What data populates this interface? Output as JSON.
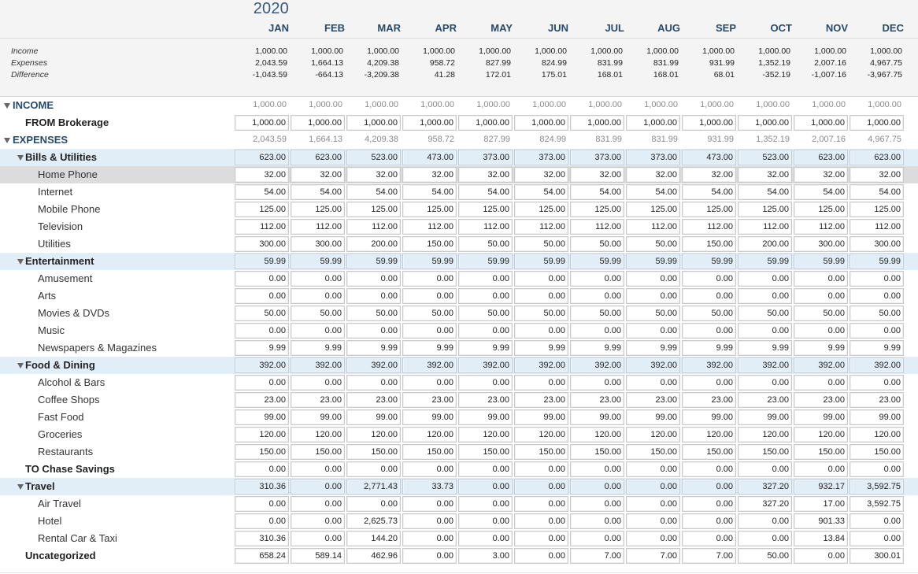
{
  "year": "2020",
  "months": [
    "JAN",
    "FEB",
    "MAR",
    "APR",
    "MAY",
    "JUN",
    "JUL",
    "AUG",
    "SEP",
    "OCT",
    "NOV",
    "DEC"
  ],
  "summary": [
    {
      "label": "Income",
      "values": [
        "1,000.00",
        "1,000.00",
        "1,000.00",
        "1,000.00",
        "1,000.00",
        "1,000.00",
        "1,000.00",
        "1,000.00",
        "1,000.00",
        "1,000.00",
        "1,000.00",
        "1,000.00"
      ]
    },
    {
      "label": "Expenses",
      "values": [
        "2,043.59",
        "1,664.13",
        "4,209.38",
        "958.72",
        "827.99",
        "824.99",
        "831.99",
        "831.99",
        "931.99",
        "1,352.19",
        "2,007.16",
        "4,967.75"
      ]
    },
    {
      "label": "Difference",
      "values": [
        "-1,043.59",
        "-664.13",
        "-3,209.38",
        "41.28",
        "172.01",
        "175.01",
        "168.01",
        "168.01",
        "68.01",
        "-352.19",
        "-1,007.16",
        "-3,967.75"
      ]
    }
  ],
  "rows": [
    {
      "label": "INCOME",
      "kind": "section",
      "values": [
        "1,000.00",
        "1,000.00",
        "1,000.00",
        "1,000.00",
        "1,000.00",
        "1,000.00",
        "1,000.00",
        "1,000.00",
        "1,000.00",
        "1,000.00",
        "1,000.00",
        "1,000.00"
      ]
    },
    {
      "label": "FROM Brokerage",
      "kind": "cat-leaf",
      "values": [
        "1,000.00",
        "1,000.00",
        "1,000.00",
        "1,000.00",
        "1,000.00",
        "1,000.00",
        "1,000.00",
        "1,000.00",
        "1,000.00",
        "1,000.00",
        "1,000.00",
        "1,000.00"
      ]
    },
    {
      "label": "EXPENSES",
      "kind": "section",
      "values": [
        "2,043.59",
        "1,664.13",
        "4,209.38",
        "958.72",
        "827.99",
        "824.99",
        "831.99",
        "831.99",
        "931.99",
        "1,352.19",
        "2,007.16",
        "4,967.75"
      ]
    },
    {
      "label": "Bills & Utilities",
      "kind": "group",
      "values": [
        "623.00",
        "623.00",
        "523.00",
        "473.00",
        "373.00",
        "373.00",
        "373.00",
        "373.00",
        "473.00",
        "523.00",
        "623.00",
        "623.00"
      ]
    },
    {
      "label": "Home Phone",
      "kind": "sub",
      "selected": true,
      "values": [
        "32.00",
        "32.00",
        "32.00",
        "32.00",
        "32.00",
        "32.00",
        "32.00",
        "32.00",
        "32.00",
        "32.00",
        "32.00",
        "32.00"
      ]
    },
    {
      "label": "Internet",
      "kind": "sub",
      "values": [
        "54.00",
        "54.00",
        "54.00",
        "54.00",
        "54.00",
        "54.00",
        "54.00",
        "54.00",
        "54.00",
        "54.00",
        "54.00",
        "54.00"
      ]
    },
    {
      "label": "Mobile Phone",
      "kind": "sub",
      "values": [
        "125.00",
        "125.00",
        "125.00",
        "125.00",
        "125.00",
        "125.00",
        "125.00",
        "125.00",
        "125.00",
        "125.00",
        "125.00",
        "125.00"
      ]
    },
    {
      "label": "Television",
      "kind": "sub",
      "values": [
        "112.00",
        "112.00",
        "112.00",
        "112.00",
        "112.00",
        "112.00",
        "112.00",
        "112.00",
        "112.00",
        "112.00",
        "112.00",
        "112.00"
      ]
    },
    {
      "label": "Utilities",
      "kind": "sub",
      "values": [
        "300.00",
        "300.00",
        "200.00",
        "150.00",
        "50.00",
        "50.00",
        "50.00",
        "50.00",
        "150.00",
        "200.00",
        "300.00",
        "300.00"
      ]
    },
    {
      "label": "Entertainment",
      "kind": "group",
      "values": [
        "59.99",
        "59.99",
        "59.99",
        "59.99",
        "59.99",
        "59.99",
        "59.99",
        "59.99",
        "59.99",
        "59.99",
        "59.99",
        "59.99"
      ]
    },
    {
      "label": "Amusement",
      "kind": "sub",
      "values": [
        "0.00",
        "0.00",
        "0.00",
        "0.00",
        "0.00",
        "0.00",
        "0.00",
        "0.00",
        "0.00",
        "0.00",
        "0.00",
        "0.00"
      ]
    },
    {
      "label": "Arts",
      "kind": "sub",
      "values": [
        "0.00",
        "0.00",
        "0.00",
        "0.00",
        "0.00",
        "0.00",
        "0.00",
        "0.00",
        "0.00",
        "0.00",
        "0.00",
        "0.00"
      ]
    },
    {
      "label": "Movies & DVDs",
      "kind": "sub",
      "values": [
        "50.00",
        "50.00",
        "50.00",
        "50.00",
        "50.00",
        "50.00",
        "50.00",
        "50.00",
        "50.00",
        "50.00",
        "50.00",
        "50.00"
      ]
    },
    {
      "label": "Music",
      "kind": "sub",
      "values": [
        "0.00",
        "0.00",
        "0.00",
        "0.00",
        "0.00",
        "0.00",
        "0.00",
        "0.00",
        "0.00",
        "0.00",
        "0.00",
        "0.00"
      ]
    },
    {
      "label": "Newspapers & Magazines",
      "kind": "sub",
      "values": [
        "9.99",
        "9.99",
        "9.99",
        "9.99",
        "9.99",
        "9.99",
        "9.99",
        "9.99",
        "9.99",
        "9.99",
        "9.99",
        "9.99"
      ]
    },
    {
      "label": "Food & Dining",
      "kind": "group",
      "values": [
        "392.00",
        "392.00",
        "392.00",
        "392.00",
        "392.00",
        "392.00",
        "392.00",
        "392.00",
        "392.00",
        "392.00",
        "392.00",
        "392.00"
      ]
    },
    {
      "label": "Alcohol & Bars",
      "kind": "sub",
      "values": [
        "0.00",
        "0.00",
        "0.00",
        "0.00",
        "0.00",
        "0.00",
        "0.00",
        "0.00",
        "0.00",
        "0.00",
        "0.00",
        "0.00"
      ]
    },
    {
      "label": "Coffee Shops",
      "kind": "sub",
      "values": [
        "23.00",
        "23.00",
        "23.00",
        "23.00",
        "23.00",
        "23.00",
        "23.00",
        "23.00",
        "23.00",
        "23.00",
        "23.00",
        "23.00"
      ]
    },
    {
      "label": "Fast Food",
      "kind": "sub",
      "values": [
        "99.00",
        "99.00",
        "99.00",
        "99.00",
        "99.00",
        "99.00",
        "99.00",
        "99.00",
        "99.00",
        "99.00",
        "99.00",
        "99.00"
      ]
    },
    {
      "label": "Groceries",
      "kind": "sub",
      "values": [
        "120.00",
        "120.00",
        "120.00",
        "120.00",
        "120.00",
        "120.00",
        "120.00",
        "120.00",
        "120.00",
        "120.00",
        "120.00",
        "120.00"
      ]
    },
    {
      "label": "Restaurants",
      "kind": "sub",
      "values": [
        "150.00",
        "150.00",
        "150.00",
        "150.00",
        "150.00",
        "150.00",
        "150.00",
        "150.00",
        "150.00",
        "150.00",
        "150.00",
        "150.00"
      ]
    },
    {
      "label": "TO Chase Savings",
      "kind": "cat-leaf",
      "values": [
        "0.00",
        "0.00",
        "0.00",
        "0.00",
        "0.00",
        "0.00",
        "0.00",
        "0.00",
        "0.00",
        "0.00",
        "0.00",
        "0.00"
      ]
    },
    {
      "label": "Travel",
      "kind": "group",
      "values": [
        "310.36",
        "0.00",
        "2,771.43",
        "33.73",
        "0.00",
        "0.00",
        "0.00",
        "0.00",
        "0.00",
        "327.20",
        "932.17",
        "3,592.75"
      ]
    },
    {
      "label": "Air Travel",
      "kind": "sub",
      "values": [
        "0.00",
        "0.00",
        "0.00",
        "0.00",
        "0.00",
        "0.00",
        "0.00",
        "0.00",
        "0.00",
        "327.20",
        "17.00",
        "3,592.75"
      ]
    },
    {
      "label": "Hotel",
      "kind": "sub",
      "values": [
        "0.00",
        "0.00",
        "2,625.73",
        "0.00",
        "0.00",
        "0.00",
        "0.00",
        "0.00",
        "0.00",
        "0.00",
        "901.33",
        "0.00"
      ]
    },
    {
      "label": "Rental Car & Taxi",
      "kind": "sub",
      "values": [
        "310.36",
        "0.00",
        "144.20",
        "0.00",
        "0.00",
        "0.00",
        "0.00",
        "0.00",
        "0.00",
        "0.00",
        "13.84",
        "0.00"
      ]
    },
    {
      "label": "Uncategorized",
      "kind": "cat-leaf",
      "values": [
        "658.24",
        "589.14",
        "462.96",
        "0.00",
        "3.00",
        "0.00",
        "7.00",
        "7.00",
        "7.00",
        "50.00",
        "0.00",
        "300.01"
      ]
    }
  ]
}
